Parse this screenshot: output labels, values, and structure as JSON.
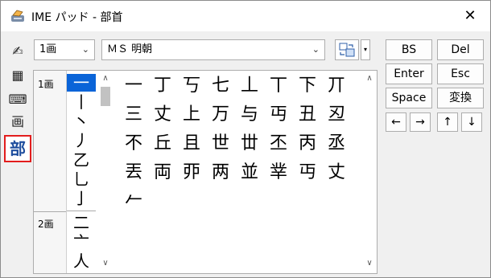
{
  "window": {
    "title": "IME パッド - 部首",
    "close_label": "✕"
  },
  "leftbar": {
    "tools": [
      {
        "name": "handwriting-tool",
        "glyph": "✍"
      },
      {
        "name": "character-list-tool",
        "glyph": "▦"
      },
      {
        "name": "soft-keyboard-tool",
        "glyph": "⌨"
      },
      {
        "name": "stroke-count-tool",
        "glyph": "画"
      },
      {
        "name": "radical-tool",
        "glyph": "部"
      }
    ]
  },
  "toolbar": {
    "stroke_combo_value": "1画",
    "font_combo_value": "ＭＳ 明朝",
    "dropdown_arrow": "⌄",
    "small_arrow": "▾"
  },
  "radicals": {
    "stroke_labels": [
      "1画",
      "2画"
    ],
    "items_1": [
      "一",
      "丨",
      "丶",
      "丿",
      "乙",
      "乚",
      "亅"
    ],
    "items_2": [
      "二",
      "亠",
      "人"
    ]
  },
  "characters": {
    "rows": [
      [
        "一",
        "丁",
        "丂",
        "七",
        "丄",
        "丅",
        "下",
        "丌"
      ],
      [
        "三",
        "丈",
        "上",
        "万",
        "与",
        "丏",
        "丑",
        "丒"
      ],
      [
        "不",
        "丘",
        "且",
        "世",
        "丗",
        "丕",
        "丙",
        "丞"
      ],
      [
        "丟",
        "両",
        "丣",
        "两",
        "並",
        "丵",
        "丏",
        "丈"
      ],
      [
        "𠂉"
      ]
    ]
  },
  "keys": {
    "bs": "BS",
    "del": "Del",
    "enter": "Enter",
    "esc": "Esc",
    "space": "Space",
    "convert": "変換",
    "left": "←",
    "right": "→",
    "up": "↑",
    "down": "↓"
  },
  "scroll": {
    "up_glyph": "∧",
    "down_glyph": "∨"
  }
}
